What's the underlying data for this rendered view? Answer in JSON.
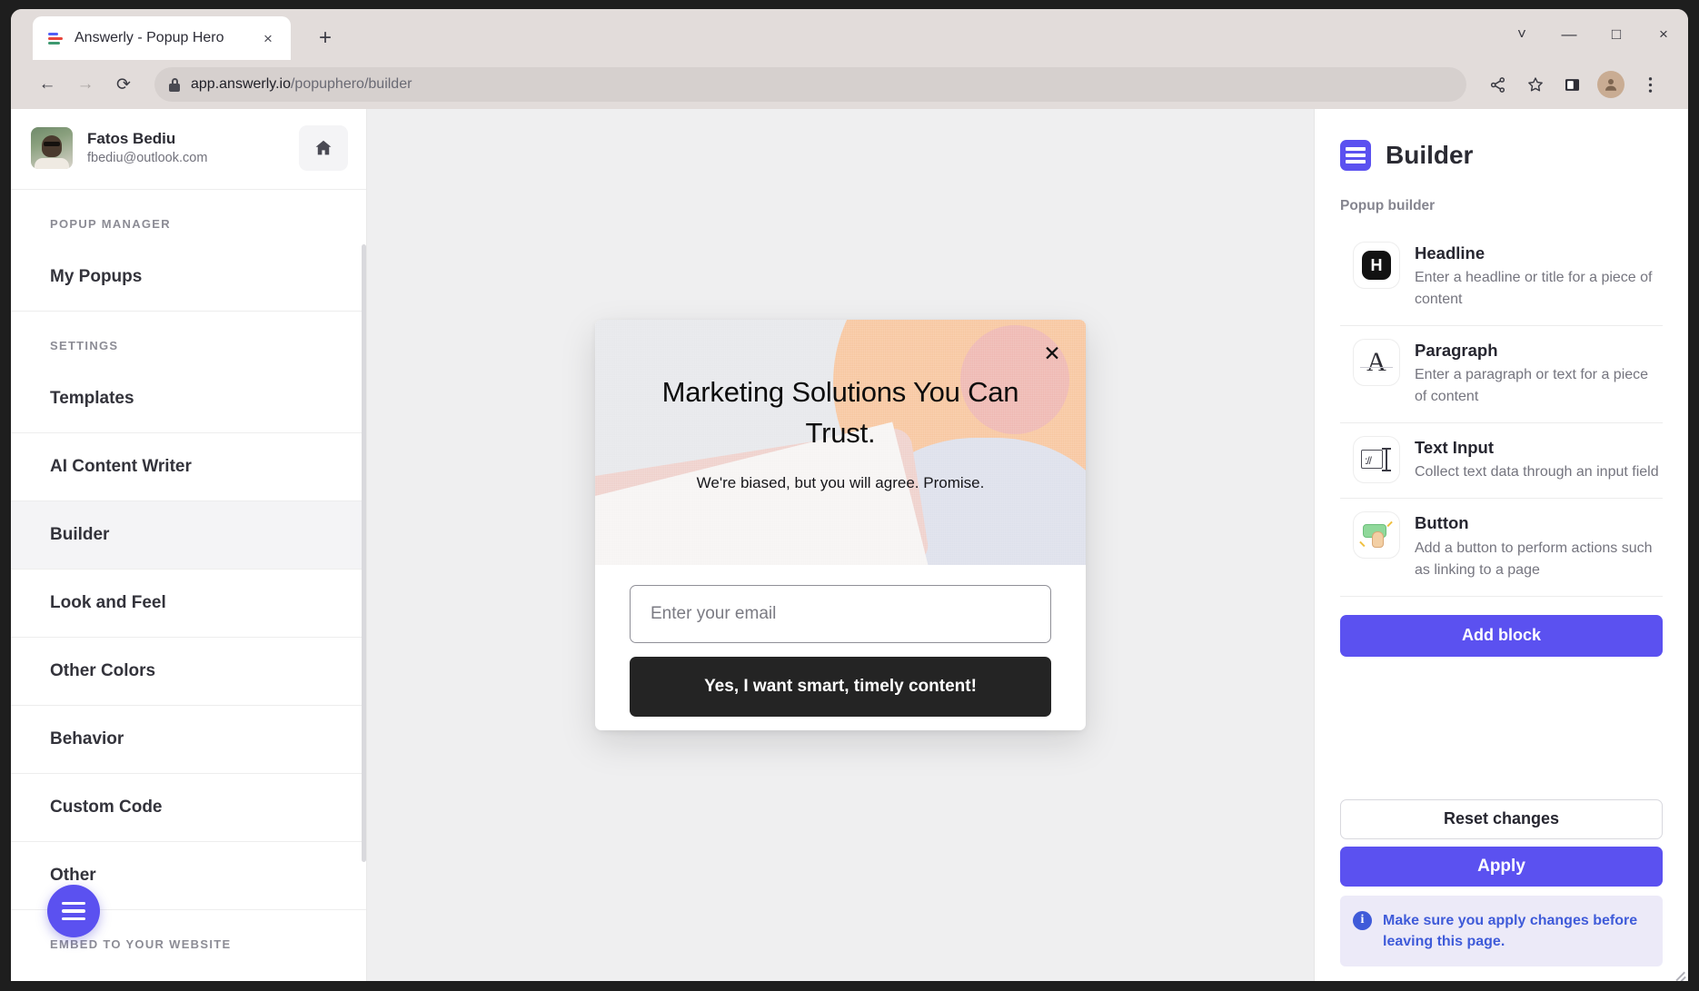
{
  "browser": {
    "tab": {
      "title": "Answerly - Popup Hero",
      "favicon": "answerly-logo-icon",
      "close": "×"
    },
    "new_tab": "+",
    "window_controls": {
      "chevron": "˅",
      "minimize": "—",
      "maximize": "□",
      "close": "×"
    },
    "nav": {
      "back": "←",
      "forward": "→",
      "reload": "⟳"
    },
    "url": {
      "domain": "app.answerly.io",
      "path": "/popuphero/builder"
    },
    "toolbar_icons": [
      "share-icon",
      "bookmark-star-icon",
      "side-panel-icon",
      "profile-avatar-icon",
      "chrome-menu-icon"
    ]
  },
  "sidebar": {
    "profile": {
      "name": "Fatos Bediu",
      "email": "fbediu@outlook.com"
    },
    "home_button": "home-icon",
    "groups": [
      {
        "label": "POPUP MANAGER",
        "items": [
          {
            "label": "My Popups",
            "active": false
          }
        ]
      },
      {
        "label": "SETTINGS",
        "items": [
          {
            "label": "Templates",
            "active": false
          },
          {
            "label": "AI Content Writer",
            "active": false
          },
          {
            "label": "Builder",
            "active": true
          },
          {
            "label": "Look and Feel",
            "active": false
          },
          {
            "label": "Other Colors",
            "active": false
          },
          {
            "label": "Behavior",
            "active": false
          },
          {
            "label": "Custom Code",
            "active": false
          },
          {
            "label": "Other",
            "active": false
          }
        ]
      },
      {
        "label": "EMBED TO YOUR WEBSITE",
        "items": []
      }
    ],
    "fab": "hamburger-menu-icon"
  },
  "popup_preview": {
    "close": "✕",
    "headline": "Marketing Solutions You Can Trust.",
    "subheadline": "We're biased, but you will agree. Promise.",
    "email_placeholder": "Enter your email",
    "cta_label": "Yes, I want smart, timely content!",
    "colors": {
      "cta_bg": "#242424",
      "hero_bg": "#e8e9ec",
      "accent_peach": "#f8c9a4",
      "accent_rose": "#f0d3ce",
      "accent_pink": "#efb8b8",
      "accent_lavender": "#dfe2ec"
    }
  },
  "right_panel": {
    "icon": "builder-icon",
    "title": "Builder",
    "section_label": "Popup builder",
    "blocks": [
      {
        "icon": "headline-h-icon",
        "title": "Headline",
        "desc": "Enter a headline or title for a piece of content"
      },
      {
        "icon": "paragraph-a-icon",
        "title": "Paragraph",
        "desc": "Enter a paragraph or text for a piece of content"
      },
      {
        "icon": "text-input-icon",
        "title": "Text Input",
        "desc": "Collect text data through an input field"
      },
      {
        "icon": "button-click-icon",
        "title": "Button",
        "desc": "Add a button to perform actions such as linking to a page"
      }
    ],
    "add_block_label": "Add block",
    "reset_label": "Reset changes",
    "apply_label": "Apply",
    "notice": {
      "icon": "info-icon",
      "glyph": "i",
      "text": "Make sure you apply changes before leaving this page."
    },
    "colors": {
      "accent": "#5b51f0",
      "notice_bg": "#eceaf8",
      "notice_text": "#3f5bd9"
    }
  }
}
